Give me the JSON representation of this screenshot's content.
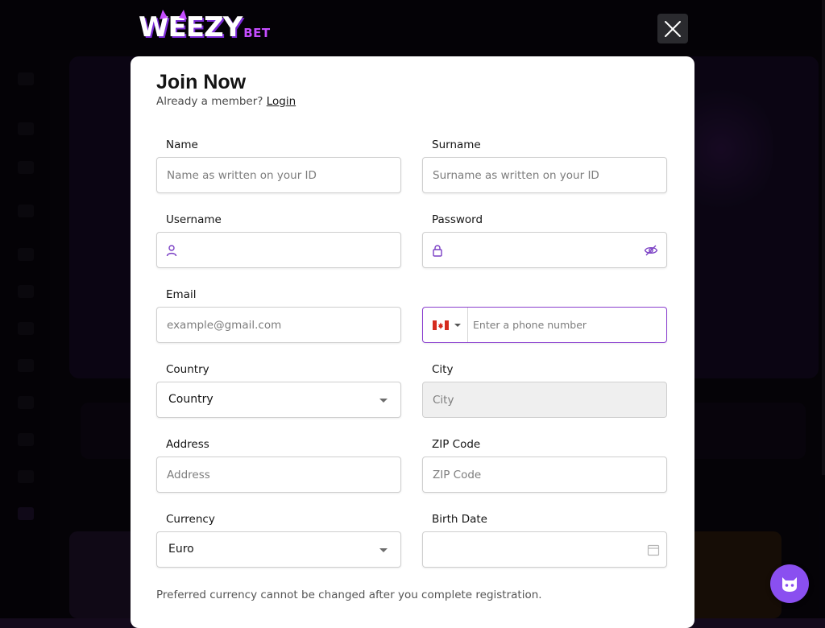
{
  "brand": {
    "name": "WEEZY",
    "suffix": "BET"
  },
  "modal": {
    "title": "Join Now",
    "login_prompt": "Already a member?",
    "login_link": "Login",
    "fields": {
      "name": {
        "label": "Name",
        "placeholder": "Name as written on your ID",
        "value": ""
      },
      "surname": {
        "label": "Surname",
        "placeholder": "Surname as written on your ID",
        "value": ""
      },
      "username": {
        "label": "Username",
        "placeholder": "",
        "value": "",
        "icon": "user-icon"
      },
      "password": {
        "label": "Password",
        "placeholder": "",
        "value": "",
        "icon": "lock-icon",
        "toggle_icon": "eye-off-icon"
      },
      "email": {
        "label": "Email",
        "placeholder": "example@gmail.com",
        "value": ""
      },
      "phone": {
        "placeholder": "Enter a phone number",
        "value": "",
        "country_flag": "canada-flag-icon"
      },
      "country": {
        "label": "Country",
        "selected": "Country"
      },
      "city": {
        "label": "City",
        "placeholder": "City",
        "value": ""
      },
      "address": {
        "label": "Address",
        "placeholder": "Address",
        "value": ""
      },
      "zip": {
        "label": "ZIP Code",
        "placeholder": "ZIP Code",
        "value": ""
      },
      "currency": {
        "label": "Currency",
        "selected": "Euro"
      },
      "birth_date": {
        "label": "Birth Date",
        "value": "",
        "icon": "calendar-icon"
      }
    },
    "currency_note": "Preferred currency cannot be changed after you complete registration."
  },
  "colors": {
    "accent": "#8a3fcf",
    "brand_purple": "#c54dff",
    "chat_button": "#8a4ff0"
  }
}
